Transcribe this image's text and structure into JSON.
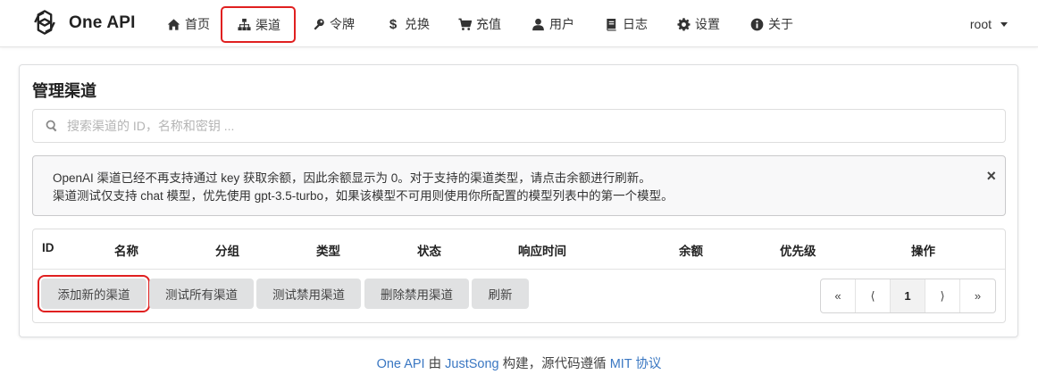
{
  "brand": {
    "name": "One API"
  },
  "nav": {
    "home": "首页",
    "channels": "渠道",
    "tokens": "令牌",
    "redeem": "兑换",
    "topup": "充值",
    "users": "用户",
    "logs": "日志",
    "settings": "设置",
    "about": "关于",
    "user": "root"
  },
  "page": {
    "title": "管理渠道",
    "search_placeholder": "搜索渠道的 ID，名称和密钥 ..."
  },
  "message": {
    "line1": "OpenAI 渠道已经不再支持通过 key 获取余额，因此余额显示为 0。对于支持的渠道类型，请点击余额进行刷新。",
    "line2": "渠道测试仅支持 chat 模型，优先使用 gpt-3.5-turbo，如果该模型不可用则使用你所配置的模型列表中的第一个模型。",
    "close": "×"
  },
  "table": {
    "columns": [
      "ID",
      "名称",
      "分组",
      "类型",
      "状态",
      "响应时间",
      "余额",
      "优先级",
      "操作"
    ]
  },
  "actions": {
    "add": "添加新的渠道",
    "test_all": "测试所有渠道",
    "test_disabled": "测试禁用渠道",
    "delete_disabled": "删除禁用渠道",
    "refresh": "刷新"
  },
  "pagination": {
    "first": "«",
    "prev": "⟨",
    "current": "1",
    "next": "⟩",
    "last": "»"
  },
  "footer": {
    "project": "One API",
    "by": " 由 ",
    "author": "JustSong",
    "built": " 构建，源代码遵循 ",
    "license": "MIT 协议"
  },
  "colors": {
    "highlight": "#e02020",
    "link": "#3a77c2",
    "button_bg": "#e0e1e2"
  }
}
